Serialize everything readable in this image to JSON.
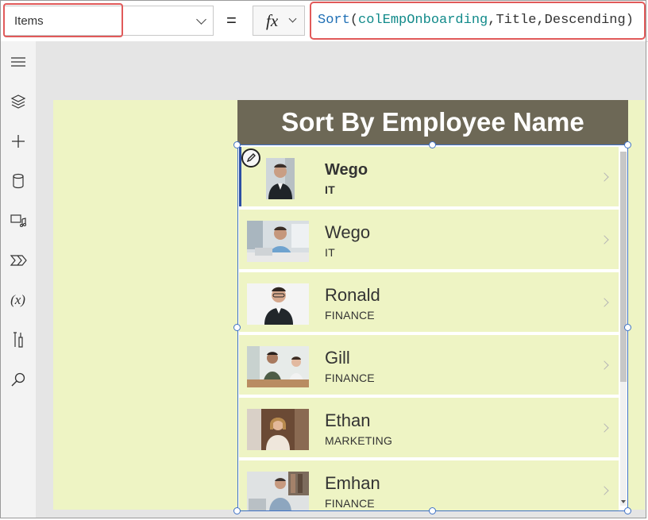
{
  "formula_bar": {
    "property": "Items",
    "equals": "=",
    "fx_label": "fx",
    "formula": {
      "fn": "Sort",
      "open": "(",
      "collection": "colEmpOnboarding",
      "comma1": ",",
      "column": "Title",
      "comma2": ",",
      "order": "Descending",
      "close": ")"
    }
  },
  "left_rail": {
    "icons": [
      "hamburger-menu-icon",
      "layers-icon",
      "plus-icon",
      "database-icon",
      "media-icon",
      "power-automate-icon",
      "variables-icon",
      "tools-icon",
      "search-icon"
    ],
    "variables_glyph": "(x)"
  },
  "screen": {
    "title": "Sort By Employee Name",
    "colors": {
      "title_bar": "#6d6856",
      "row_background": "#eef4c4",
      "selection": "#3f72c6",
      "highlight_box": "#e15a5a"
    }
  },
  "gallery": {
    "items": [
      {
        "name": "Wego",
        "department": "IT",
        "selected": true
      },
      {
        "name": "Wego",
        "department": "IT",
        "selected": false
      },
      {
        "name": "Ronald",
        "department": "FINANCE",
        "selected": false
      },
      {
        "name": "Gill",
        "department": "FINANCE",
        "selected": false
      },
      {
        "name": "Ethan",
        "department": "MARKETING",
        "selected": false
      },
      {
        "name": "Emhan",
        "department": "FINANCE",
        "selected": false
      }
    ]
  }
}
